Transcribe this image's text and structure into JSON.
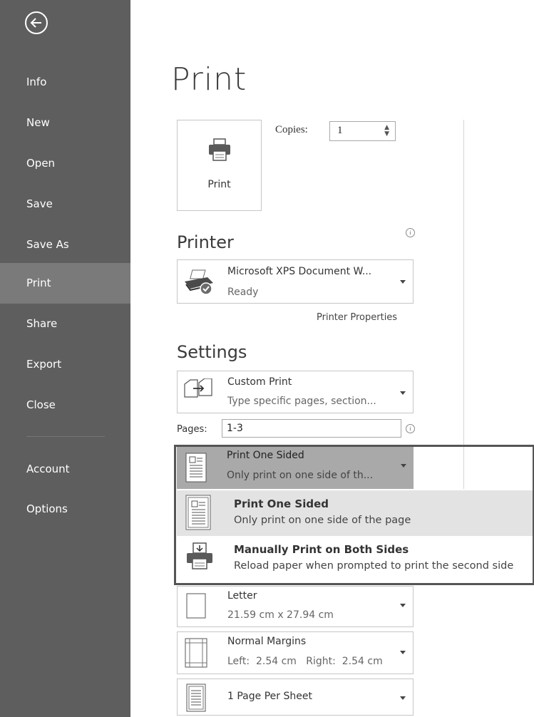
{
  "sidebar": {
    "items": [
      {
        "label": "Info"
      },
      {
        "label": "New"
      },
      {
        "label": "Open"
      },
      {
        "label": "Save"
      },
      {
        "label": "Save As"
      },
      {
        "label": "Print",
        "active": true
      },
      {
        "label": "Share"
      },
      {
        "label": "Export"
      },
      {
        "label": "Close"
      },
      {
        "label": "Account"
      },
      {
        "label": "Options"
      }
    ]
  },
  "main": {
    "title": "Print",
    "print_button_label": "Print",
    "copies": {
      "label": "Copies:",
      "value": "1"
    },
    "printer": {
      "heading": "Printer",
      "info_glyph": "i",
      "name": "Microsoft XPS Document W...",
      "status": "Ready",
      "properties_link": "Printer Properties"
    },
    "settings": {
      "heading": "Settings",
      "range": {
        "title": "Custom Print",
        "subtitle": "Type specific pages, section..."
      },
      "pages": {
        "label": "Pages:",
        "value": "1-3",
        "info_glyph": "i"
      },
      "sided": {
        "title": "Print One Sided",
        "subtitle": "Only print on one side of th..."
      },
      "sided_menu": [
        {
          "title": "Print One Sided",
          "subtitle": "Only print on one side of the page",
          "selected": true
        },
        {
          "title": "Manually Print on Both Sides",
          "subtitle": "Reload paper when prompted to print the second side",
          "selected": false
        }
      ],
      "paper": {
        "title": "Letter",
        "subtitle": "21.59 cm x 27.94 cm"
      },
      "margins": {
        "title": "Normal Margins",
        "subtitle": "Left:  2.54 cm   Right:  2.54 cm"
      },
      "per_sheet": {
        "title": "1 Page Per Sheet"
      }
    }
  },
  "colors": {
    "sidebar_bg": "#5e5e5e",
    "sidebar_active": "#7a7a7a",
    "highlight_head": "#a9a9a9",
    "menu_selected": "#e3e3e3"
  }
}
